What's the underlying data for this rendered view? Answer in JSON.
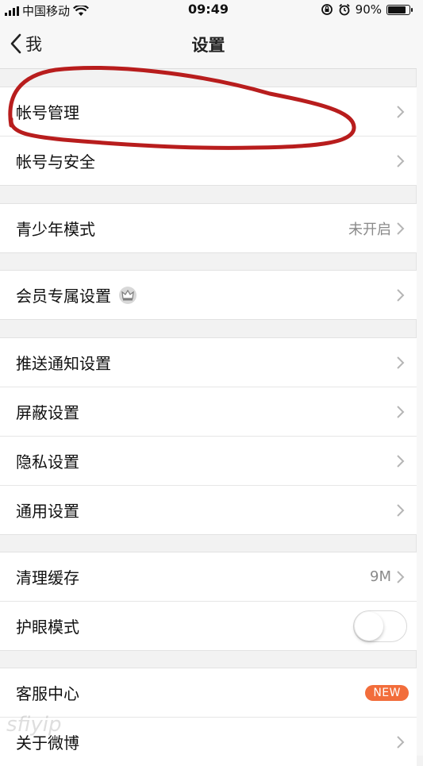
{
  "status_bar": {
    "carrier": "中国移动",
    "time": "09:49",
    "battery": "90%",
    "battery_level": 0.9
  },
  "nav": {
    "back_label": "我",
    "title": "设置"
  },
  "groups": [
    {
      "items": [
        {
          "label": "帐号管理",
          "chevron": true
        },
        {
          "label": "帐号与安全",
          "chevron": true
        }
      ]
    },
    {
      "items": [
        {
          "label": "青少年模式",
          "value": "未开启",
          "chevron": true
        }
      ]
    },
    {
      "items": [
        {
          "label": "会员专属设置",
          "icon": "crown-icon",
          "chevron": true
        }
      ]
    },
    {
      "items": [
        {
          "label": "推送通知设置",
          "chevron": true
        },
        {
          "label": "屏蔽设置",
          "chevron": true
        },
        {
          "label": "隐私设置",
          "chevron": true
        },
        {
          "label": "通用设置",
          "chevron": true
        }
      ]
    },
    {
      "items": [
        {
          "label": "清理缓存",
          "value": "9M",
          "chevron": true
        },
        {
          "label": "护眼模式",
          "toggle": false
        }
      ]
    },
    {
      "items": [
        {
          "label": "客服中心",
          "badge": "NEW"
        },
        {
          "label": "关于微博",
          "chevron": true
        }
      ]
    }
  ],
  "colors": {
    "annotation": "#b81d1d",
    "badge": "#f26d3b"
  }
}
